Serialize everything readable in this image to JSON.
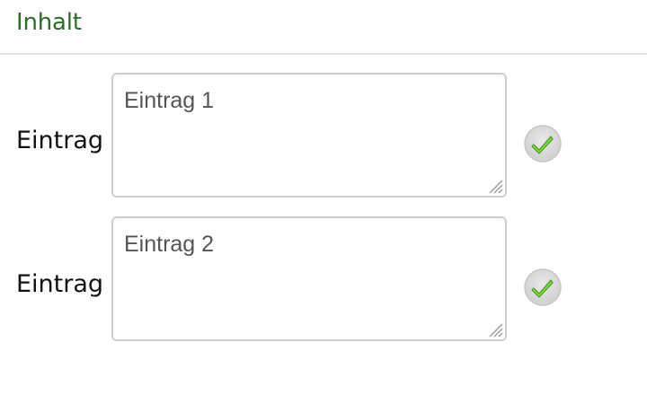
{
  "section": {
    "title": "Inhalt"
  },
  "entries": [
    {
      "label": "Eintrag",
      "value": "Eintrag 1",
      "status_icon": "check-circle-icon"
    },
    {
      "label": "Eintrag",
      "value": "Eintrag 2",
      "status_icon": "check-circle-icon"
    }
  ],
  "colors": {
    "title": "#2f6b2a",
    "check_fill": "#7ddc3a",
    "check_stroke": "#4a9a1e",
    "icon_bg": "#d7d7d7"
  }
}
